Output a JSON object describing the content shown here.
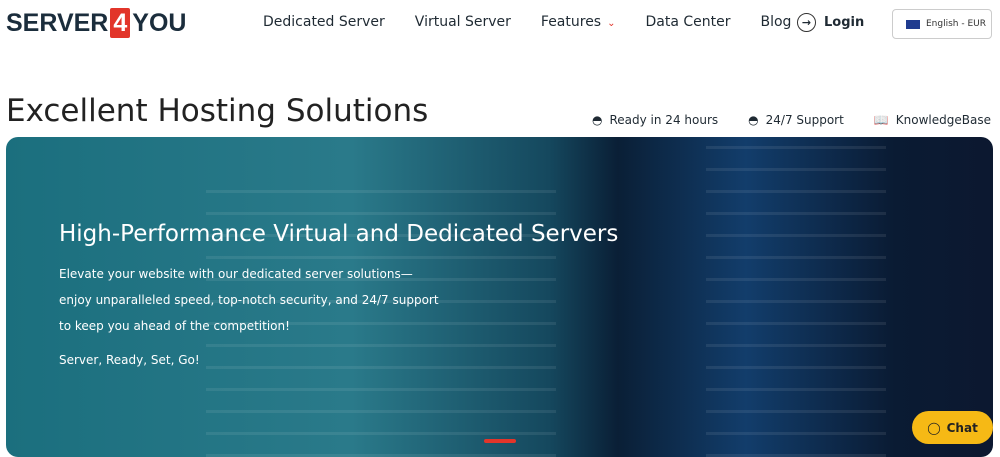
{
  "logo": {
    "text_a": "SERVER",
    "text_b": "4",
    "text_c": "YOU"
  },
  "nav": [
    "Dedicated Server",
    "Virtual Server",
    "Features",
    "Data Center",
    "Blog"
  ],
  "login": "Login",
  "language": "English - EUR",
  "title": "Excellent Hosting Solutions",
  "features": [
    "Ready in 24 hours",
    "24/7 Support",
    "KnowledgeBase"
  ],
  "hero": {
    "heading": "High-Performance Virtual and Dedicated Servers",
    "body": "Elevate your website with our dedicated server solutions—enjoy unparalleled speed, top-notch security, and 24/7 support to keep you ahead of the competition!",
    "tagline": "Server, Ready, Set, Go!"
  },
  "chat": "Chat"
}
